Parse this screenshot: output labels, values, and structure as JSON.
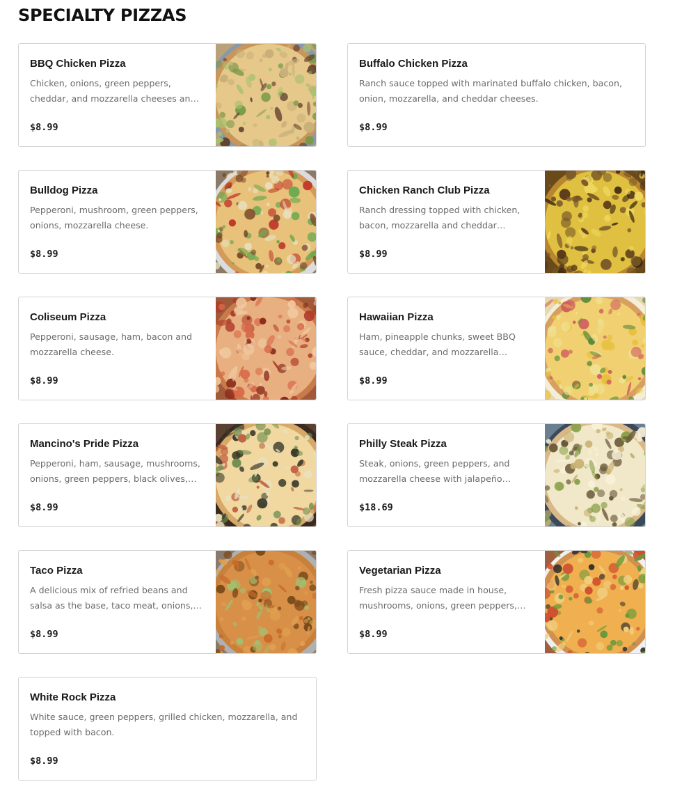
{
  "section": {
    "title": "SPECIALTY PIZZAS"
  },
  "items": [
    {
      "name": "BBQ Chicken Pizza",
      "description": "Chicken, onions, green peppers, cheddar, and mozzarella cheeses and BBQ sauce.",
      "price": "$8.99",
      "has_image": true,
      "image": "bbq-chicken-pizza-photo"
    },
    {
      "name": "Buffalo Chicken Pizza",
      "description": "Ranch sauce topped with marinated buffalo chicken, bacon, onion, mozzarella, and cheddar cheeses.",
      "price": "$8.99",
      "has_image": false
    },
    {
      "name": "Bulldog Pizza",
      "description": "Pepperoni, mushroom, green peppers, onions, mozzarella cheese.",
      "price": "$8.99",
      "has_image": true,
      "image": "bulldog-pizza-photo"
    },
    {
      "name": "Chicken Ranch Club Pizza",
      "description": "Ranch dressing topped with chicken, bacon, mozzarella and cheddar cheeses.",
      "price": "$8.99",
      "has_image": true,
      "image": "chicken-ranch-club-pizza-photo"
    },
    {
      "name": "Coliseum Pizza",
      "description": "Pepperoni, sausage, ham, bacon and mozzarella cheese.",
      "price": "$8.99",
      "has_image": true,
      "image": "coliseum-pizza-photo"
    },
    {
      "name": "Hawaiian Pizza",
      "description": "Ham, pineapple chunks, sweet BBQ sauce, cheddar, and mozzarella cheese.",
      "price": "$8.99",
      "has_image": true,
      "image": "hawaiian-pizza-photo"
    },
    {
      "name": "Mancino's Pride Pizza",
      "description": "Pepperoni, ham, sausage, mushrooms, onions, green peppers, black olives, and mozzarella cheese.",
      "price": "$8.99",
      "has_image": true,
      "image": "mancinos-pride-pizza-photo"
    },
    {
      "name": "Philly Steak Pizza",
      "description": "Steak, onions, green peppers, and mozzarella cheese with jalapeño peppers.",
      "price": "$18.69",
      "has_image": true,
      "image": "philly-steak-pizza-photo"
    },
    {
      "name": "Taco Pizza",
      "description": "A delicious mix of refried beans and salsa as the base, taco meat, onions, lettuce, tomatoes, and cheddar cheese.",
      "price": "$8.99",
      "has_image": true,
      "image": "taco-pizza-photo"
    },
    {
      "name": "Vegetarian Pizza",
      "description": "Fresh pizza sauce made in house, mushrooms, onions, green peppers, black olives, tomatoes, and mozzarella.",
      "price": "$8.99",
      "has_image": true,
      "image": "vegetarian-pizza-photo"
    },
    {
      "name": "White Rock Pizza",
      "description": "White sauce, green peppers, grilled chicken, mozzarella, and topped with bacon.",
      "price": "$8.99",
      "has_image": false
    }
  ]
}
